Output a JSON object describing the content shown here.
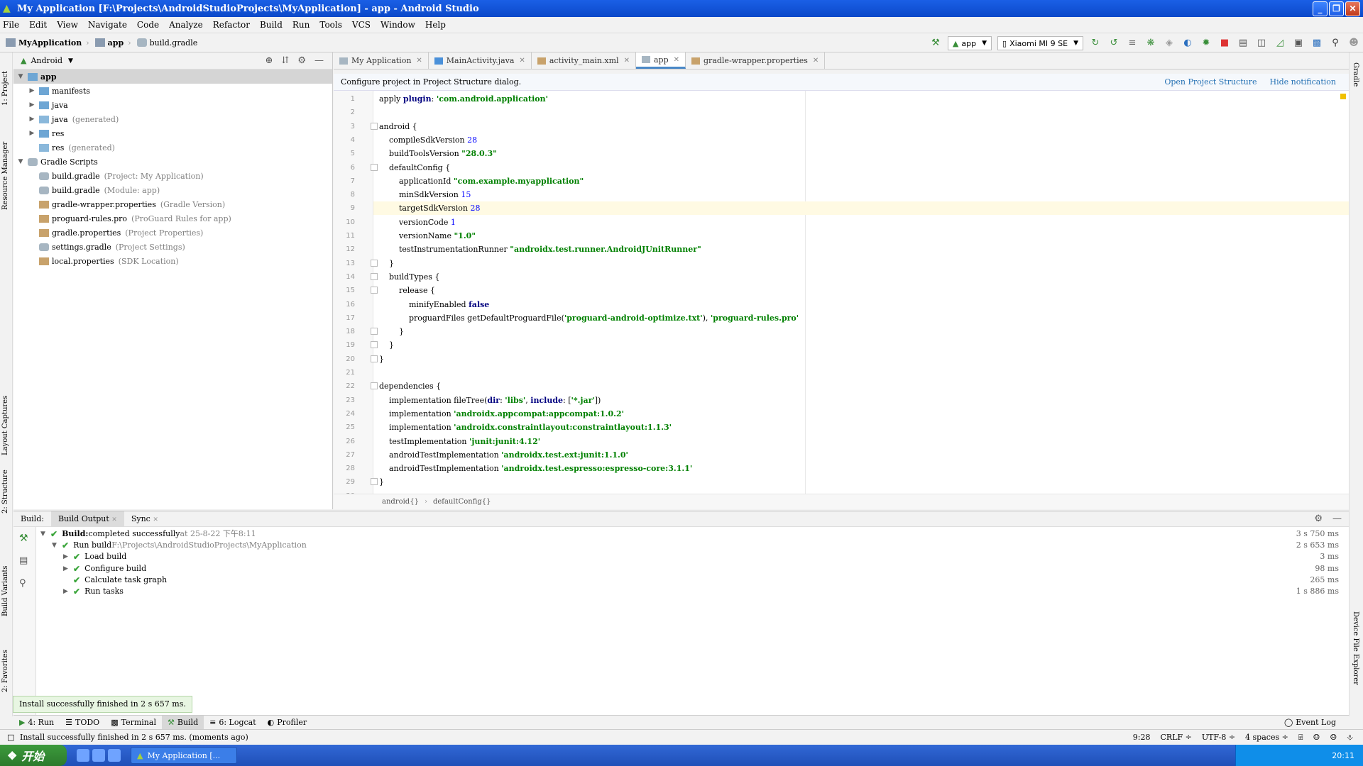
{
  "window": {
    "title": "My Application [F:\\Projects\\AndroidStudioProjects\\MyApplication] - app - Android Studio"
  },
  "menu": [
    "File",
    "Edit",
    "View",
    "Navigate",
    "Code",
    "Analyze",
    "Refactor",
    "Build",
    "Run",
    "Tools",
    "VCS",
    "Window",
    "Help"
  ],
  "breadcrumb": [
    "MyApplication",
    "app",
    "build.gradle"
  ],
  "toolbar": {
    "run_config": "app",
    "device": "Xiaomi MI 9 SE"
  },
  "left_strip": [
    "1: Project",
    "Resource Manager",
    "Layout Captures",
    "2: Structure",
    "Build Variants",
    "2: Favorites"
  ],
  "right_strip": [
    "Gradle",
    "Device File Explorer"
  ],
  "project": {
    "view_mode": "Android",
    "tree": [
      {
        "label": "app",
        "hint": "",
        "indent": 0,
        "toggle": "▼",
        "icon": "folder",
        "selected": true
      },
      {
        "label": "manifests",
        "hint": "",
        "indent": 1,
        "toggle": "▶",
        "icon": "folder"
      },
      {
        "label": "java",
        "hint": "",
        "indent": 1,
        "toggle": "▶",
        "icon": "folder"
      },
      {
        "label": "java",
        "hint": "(generated)",
        "indent": 1,
        "toggle": "▶",
        "icon": "gen"
      },
      {
        "label": "res",
        "hint": "",
        "indent": 1,
        "toggle": "▶",
        "icon": "folder"
      },
      {
        "label": "res",
        "hint": "(generated)",
        "indent": 1,
        "toggle": "",
        "icon": "gen"
      },
      {
        "label": "Gradle Scripts",
        "hint": "",
        "indent": 0,
        "toggle": "▼",
        "icon": "gradle"
      },
      {
        "label": "build.gradle",
        "hint": "(Project: My Application)",
        "indent": 1,
        "toggle": "",
        "icon": "gradle"
      },
      {
        "label": "build.gradle",
        "hint": "(Module: app)",
        "indent": 1,
        "toggle": "",
        "icon": "gradle"
      },
      {
        "label": "gradle-wrapper.properties",
        "hint": "(Gradle Version)",
        "indent": 1,
        "toggle": "",
        "icon": "file"
      },
      {
        "label": "proguard-rules.pro",
        "hint": "(ProGuard Rules for app)",
        "indent": 1,
        "toggle": "",
        "icon": "file"
      },
      {
        "label": "gradle.properties",
        "hint": "(Project Properties)",
        "indent": 1,
        "toggle": "",
        "icon": "file"
      },
      {
        "label": "settings.gradle",
        "hint": "(Project Settings)",
        "indent": 1,
        "toggle": "",
        "icon": "gradle"
      },
      {
        "label": "local.properties",
        "hint": "(SDK Location)",
        "indent": 1,
        "toggle": "",
        "icon": "file"
      }
    ]
  },
  "tabs": [
    {
      "label": "My Application",
      "active": false,
      "icon_color": "#a7b6c2"
    },
    {
      "label": "MainActivity.java",
      "active": false,
      "icon_color": "#4a90d9"
    },
    {
      "label": "activity_main.xml",
      "active": false,
      "icon_color": "#c8a26b"
    },
    {
      "label": "app",
      "active": true,
      "icon_color": "#a7b6c2"
    },
    {
      "label": "gradle-wrapper.properties",
      "active": false,
      "icon_color": "#c8a26b"
    }
  ],
  "notification": {
    "text": "Configure project in Project Structure dialog.",
    "link1": "Open Project Structure",
    "link2": "Hide notification"
  },
  "code": [
    [
      {
        "t": "apply ",
        "c": "ident"
      },
      {
        "t": "plugin",
        "c": "kw"
      },
      {
        "t": ": ",
        "c": "ident"
      },
      {
        "t": "'com.android.application'",
        "c": "str"
      }
    ],
    [],
    [
      {
        "t": "android {",
        "c": "ident"
      }
    ],
    [
      {
        "t": "    compileSdkVersion ",
        "c": "ident"
      },
      {
        "t": "28",
        "c": "num"
      }
    ],
    [
      {
        "t": "    buildToolsVersion ",
        "c": "ident"
      },
      {
        "t": "\"28.0.3\"",
        "c": "str"
      }
    ],
    [
      {
        "t": "    defaultConfig {",
        "c": "ident"
      }
    ],
    [
      {
        "t": "        applicationId ",
        "c": "ident"
      },
      {
        "t": "\"com.example.myapplication\"",
        "c": "str"
      }
    ],
    [
      {
        "t": "        minSdkVersion ",
        "c": "ident"
      },
      {
        "t": "15",
        "c": "num"
      }
    ],
    [
      {
        "t": "        targetSdkVersion ",
        "c": "ident"
      },
      {
        "t": "28",
        "c": "num"
      }
    ],
    [
      {
        "t": "        versionCode ",
        "c": "ident"
      },
      {
        "t": "1",
        "c": "num"
      }
    ],
    [
      {
        "t": "        versionName ",
        "c": "ident"
      },
      {
        "t": "\"1.0\"",
        "c": "str"
      }
    ],
    [
      {
        "t": "        testInstrumentationRunner ",
        "c": "ident"
      },
      {
        "t": "\"androidx.test.runner.AndroidJUnitRunner\"",
        "c": "str"
      }
    ],
    [
      {
        "t": "    }",
        "c": "ident"
      }
    ],
    [
      {
        "t": "    buildTypes {",
        "c": "ident"
      }
    ],
    [
      {
        "t": "        release {",
        "c": "ident"
      }
    ],
    [
      {
        "t": "            minifyEnabled ",
        "c": "ident"
      },
      {
        "t": "false",
        "c": "kw"
      }
    ],
    [
      {
        "t": "            proguardFiles getDefaultProguardFile(",
        "c": "ident"
      },
      {
        "t": "'proguard-android-optimize.txt'",
        "c": "str"
      },
      {
        "t": "), ",
        "c": "ident"
      },
      {
        "t": "'proguard-rules.pro'",
        "c": "str"
      }
    ],
    [
      {
        "t": "        }",
        "c": "ident"
      }
    ],
    [
      {
        "t": "    }",
        "c": "ident"
      }
    ],
    [
      {
        "t": "}",
        "c": "ident"
      }
    ],
    [],
    [
      {
        "t": "dependencies {",
        "c": "ident"
      }
    ],
    [
      {
        "t": "    implementation fileTree(",
        "c": "ident"
      },
      {
        "t": "dir",
        "c": "kw"
      },
      {
        "t": ": ",
        "c": "ident"
      },
      {
        "t": "'libs'",
        "c": "str"
      },
      {
        "t": ", ",
        "c": "ident"
      },
      {
        "t": "include",
        "c": "kw"
      },
      {
        "t": ": [",
        "c": "ident"
      },
      {
        "t": "'*.jar'",
        "c": "str"
      },
      {
        "t": "])",
        "c": "ident"
      }
    ],
    [
      {
        "t": "    implementation ",
        "c": "ident"
      },
      {
        "t": "'androidx.appcompat:appcompat:1.0.2'",
        "c": "str"
      }
    ],
    [
      {
        "t": "    implementation ",
        "c": "ident"
      },
      {
        "t": "'androidx.constraintlayout:constraintlayout:1.1.3'",
        "c": "str"
      }
    ],
    [
      {
        "t": "    testImplementation ",
        "c": "ident"
      },
      {
        "t": "'junit:junit:4.12'",
        "c": "str"
      }
    ],
    [
      {
        "t": "    androidTestImplementation ",
        "c": "ident"
      },
      {
        "t": "'androidx.test.ext:junit:1.1.0'",
        "c": "str"
      }
    ],
    [
      {
        "t": "    androidTestImplementation ",
        "c": "ident"
      },
      {
        "t": "'androidx.test.espresso:espresso-core:3.1.1'",
        "c": "str"
      }
    ],
    [
      {
        "t": "}",
        "c": "ident"
      }
    ],
    []
  ],
  "highlight_line": 9,
  "editor_breadcrumb": [
    "android{}",
    "defaultConfig{}"
  ],
  "build": {
    "label": "Build:",
    "tabs": [
      "Build Output",
      "Sync"
    ],
    "rows": [
      {
        "indent": 0,
        "toggle": "▼",
        "bold": "Build:",
        "text": " completed successfully",
        "dim": " at 25-8-22 下午8:11",
        "time": "3 s 750 ms"
      },
      {
        "indent": 1,
        "toggle": "▼",
        "bold": "",
        "text": "Run build",
        "dim": " F:\\Projects\\AndroidStudioProjects\\MyApplication",
        "time": "2 s 653 ms"
      },
      {
        "indent": 2,
        "toggle": "▶",
        "bold": "",
        "text": "Load build",
        "dim": "",
        "time": "3 ms"
      },
      {
        "indent": 2,
        "toggle": "▶",
        "bold": "",
        "text": "Configure build",
        "dim": "",
        "time": "98 ms"
      },
      {
        "indent": 2,
        "toggle": "",
        "bold": "",
        "text": "Calculate task graph",
        "dim": "",
        "time": "265 ms"
      },
      {
        "indent": 2,
        "toggle": "▶",
        "bold": "",
        "text": "Run tasks",
        "dim": "",
        "time": "1 s 886 ms"
      }
    ]
  },
  "toast": "Install successfully finished in 2 s 657 ms.",
  "tool_windows": [
    "4: Run",
    "TODO",
    "Terminal",
    "Build",
    "6: Logcat",
    "Profiler"
  ],
  "event_log": "Event Log",
  "status": {
    "message": "Install successfully finished in 2 s 657 ms. (moments ago)",
    "position": "9:28",
    "line_sep": "CRLF ÷",
    "encoding": "UTF-8 ÷",
    "indent": "4 spaces ÷"
  },
  "taskbar": {
    "start": "开始",
    "item": "My Application [...",
    "clock": "20:11"
  }
}
